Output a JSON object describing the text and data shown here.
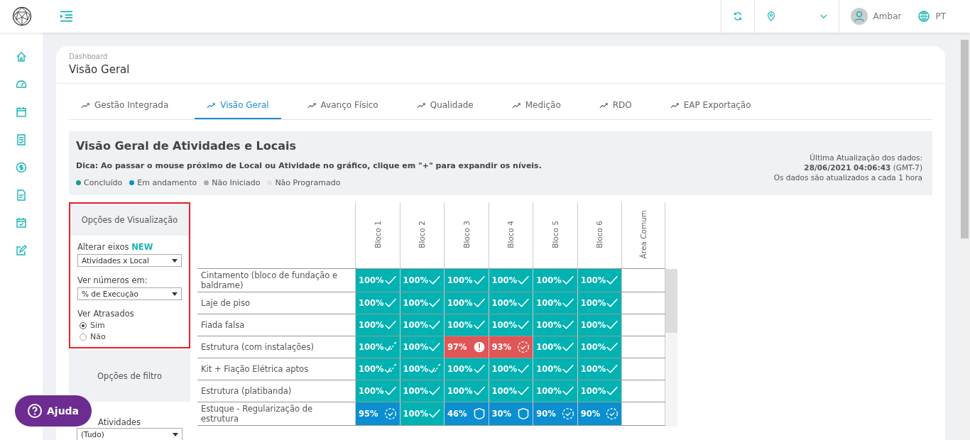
{
  "topbar": {
    "user": "Ambar",
    "language": "PT"
  },
  "breadcrumb": "Dashboard",
  "page_title": "Visão Geral",
  "tabs": [
    {
      "label": "Gestão Integrada",
      "selected": false
    },
    {
      "label": "Visão Geral",
      "selected": true
    },
    {
      "label": "Avanço Físico",
      "selected": false
    },
    {
      "label": "Qualidade",
      "selected": false
    },
    {
      "label": "Medição",
      "selected": false
    },
    {
      "label": "RDO",
      "selected": false
    },
    {
      "label": "EAP Exportação",
      "selected": false
    }
  ],
  "panel": {
    "title": "Visão Geral de Atividades e Locais",
    "tip": "Dica: Ao passar o mouse próximo de Local ou Atividade no gráfico, clique em \"+\" para expandir os níveis.",
    "legend": [
      {
        "label": "Concluído",
        "color": "#1a9a8c"
      },
      {
        "label": "Em andamento",
        "color": "#0a8fd0"
      },
      {
        "label": "Não Iniciado",
        "color": "#b3aaa6"
      },
      {
        "label": "Não Programado",
        "color": "#eadfdb"
      }
    ],
    "update_label": "Última Atualização dos dados:",
    "update_time": "28/06/2021 04:06:43",
    "update_tz": "(GMT-7)",
    "update_note": "Os dados são atualizados a cada 1 hora"
  },
  "view_options": {
    "title": "Opções de Visualização",
    "axes_label": "Alterar eixos",
    "axes_badge": "NEW",
    "axes_value": "Atividades x Local",
    "numbers_label": "Ver números em:",
    "numbers_value": "% de Execução",
    "late_label": "Ver Atrasados",
    "late_options": [
      {
        "label": "Sim",
        "selected": true
      },
      {
        "label": "Não",
        "selected": false
      }
    ]
  },
  "filter_options": {
    "title": "Opções de filtro",
    "activities_label": "Atividades",
    "activities_value": "(Tudo)"
  },
  "help_button": "Ajuda",
  "matrix": {
    "columns": [
      "Bloco 1",
      "Bloco 2",
      "Bloco 3",
      "Bloco 4",
      "Bloco 5",
      "Bloco 6",
      "Área Comum"
    ],
    "rows": [
      {
        "label": "Cintamento (bloco de fundação e baldrame)",
        "cells": [
          {
            "value": "100%",
            "kind": "done"
          },
          {
            "value": "100%",
            "kind": "done"
          },
          {
            "value": "100%",
            "kind": "done"
          },
          {
            "value": "100%",
            "kind": "done"
          },
          {
            "value": "100%",
            "kind": "done"
          },
          {
            "value": "100%",
            "kind": "done"
          },
          {
            "kind": "empty"
          }
        ]
      },
      {
        "label": "Laje de piso",
        "cells": [
          {
            "value": "100%",
            "kind": "done"
          },
          {
            "value": "100%",
            "kind": "done"
          },
          {
            "value": "100%",
            "kind": "done"
          },
          {
            "value": "100%",
            "kind": "done"
          },
          {
            "value": "100%",
            "kind": "done"
          },
          {
            "value": "100%",
            "kind": "done"
          },
          {
            "kind": "empty"
          }
        ]
      },
      {
        "label": "Fiada falsa",
        "cells": [
          {
            "value": "100%",
            "kind": "done"
          },
          {
            "value": "100%",
            "kind": "done"
          },
          {
            "value": "100%",
            "kind": "done"
          },
          {
            "value": "100%",
            "kind": "done"
          },
          {
            "value": "100%",
            "kind": "done"
          },
          {
            "value": "100%",
            "kind": "done"
          },
          {
            "kind": "empty"
          }
        ]
      },
      {
        "label": "Estrutura (com instalações)",
        "cells": [
          {
            "value": "100%",
            "kind": "verified"
          },
          {
            "value": "100%",
            "kind": "done"
          },
          {
            "value": "97%",
            "kind": "overdue"
          },
          {
            "value": "93%",
            "kind": "overduepending"
          },
          {
            "value": "100%",
            "kind": "done"
          },
          {
            "value": "100%",
            "kind": "done"
          },
          {
            "kind": "empty"
          }
        ]
      },
      {
        "label": "Kit + Fiação Elétrica aptos",
        "cells": [
          {
            "value": "100%",
            "kind": "verified"
          },
          {
            "value": "100%",
            "kind": "verified"
          },
          {
            "value": "100%",
            "kind": "done"
          },
          {
            "value": "100%",
            "kind": "done"
          },
          {
            "value": "100%",
            "kind": "done"
          },
          {
            "value": "100%",
            "kind": "done"
          },
          {
            "kind": "empty"
          }
        ]
      },
      {
        "label": "Estrutura (platibanda)",
        "cells": [
          {
            "value": "100%",
            "kind": "done"
          },
          {
            "value": "100%",
            "kind": "done"
          },
          {
            "value": "100%",
            "kind": "done"
          },
          {
            "value": "100%",
            "kind": "done"
          },
          {
            "value": "100%",
            "kind": "done"
          },
          {
            "value": "100%",
            "kind": "done"
          },
          {
            "kind": "empty"
          }
        ]
      },
      {
        "label": "Estuque - Regularização de estrutura",
        "cells": [
          {
            "value": "95%",
            "kind": "ongoing"
          },
          {
            "value": "100%",
            "kind": "done"
          },
          {
            "value": "46%",
            "kind": "started"
          },
          {
            "value": "30%",
            "kind": "started"
          },
          {
            "value": "90%",
            "kind": "ongoing"
          },
          {
            "value": "90%",
            "kind": "ongoing"
          },
          {
            "kind": "empty"
          }
        ]
      }
    ]
  }
}
